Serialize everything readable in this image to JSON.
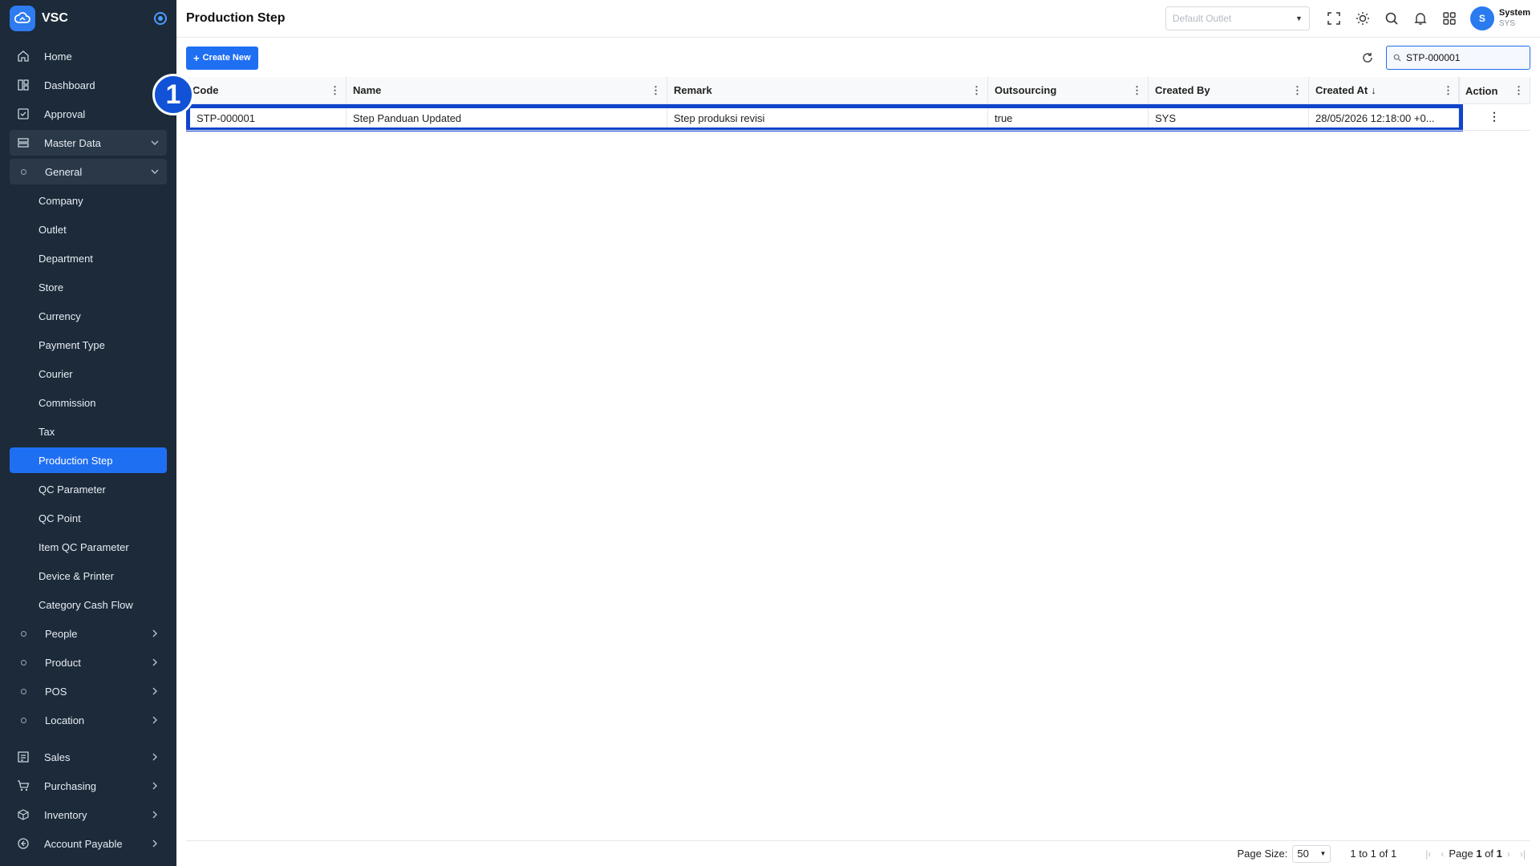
{
  "app": {
    "name": "VSC"
  },
  "sidebar": {
    "top_items": [
      {
        "label": "Home",
        "icon": "home-icon"
      },
      {
        "label": "Dashboard",
        "icon": "dashboard-icon"
      },
      {
        "label": "Approval",
        "icon": "approval-icon"
      }
    ],
    "master_data_label": "Master Data",
    "general_label": "General",
    "general_items": [
      "Company",
      "Outlet",
      "Department",
      "Store",
      "Currency",
      "Payment Type",
      "Courier",
      "Commission",
      "Tax",
      "Production Step",
      "QC Parameter",
      "QC Point",
      "Item QC Parameter",
      "Device & Printer",
      "Category Cash Flow"
    ],
    "active_item": "Production Step",
    "other_groups": [
      "People",
      "Product",
      "POS",
      "Location"
    ],
    "bottom_items": [
      {
        "label": "Sales",
        "icon": "sales-icon"
      },
      {
        "label": "Purchasing",
        "icon": "cart-icon"
      },
      {
        "label": "Inventory",
        "icon": "box-icon"
      },
      {
        "label": "Account Payable",
        "icon": "account-payable-icon"
      }
    ]
  },
  "header": {
    "title": "Production Step",
    "outlet_placeholder": "Default Outlet",
    "user_initial": "S",
    "user_name": "System",
    "user_code": "SYS"
  },
  "toolbar": {
    "create_label": "Create New",
    "search_value": "STP-000001"
  },
  "table": {
    "columns": [
      "Code",
      "Name",
      "Remark",
      "Outsourcing",
      "Created By",
      "Created At",
      "Action"
    ],
    "sort_column": "Created At",
    "rows": [
      {
        "code": "STP-000001",
        "name": "Step Panduan Updated",
        "remark": "Step produksi revisi",
        "outsourcing": "true",
        "created_by": "SYS",
        "created_at": "28/05/2026 12:18:00 +0..."
      }
    ]
  },
  "annotation": {
    "badge": "1"
  },
  "footer": {
    "page_size_label": "Page Size:",
    "page_size": "50",
    "range_text": "1 to 1 of 1",
    "page_prefix": "Page",
    "page_current": "1",
    "page_of": "of",
    "page_total": "1"
  },
  "colors": {
    "accent": "#1f6ff2",
    "sidebar": "#1c2a39",
    "highlight": "#1144cc"
  }
}
